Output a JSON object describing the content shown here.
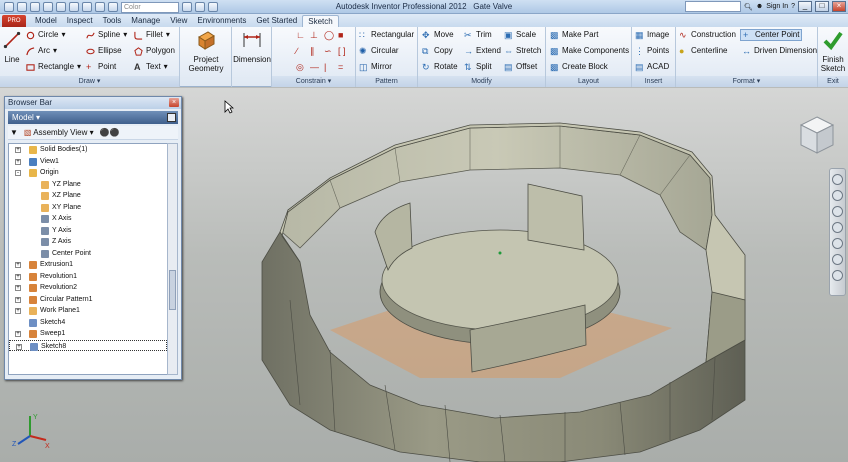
{
  "titlebar": {
    "title": "Autodesk Inventor Professional 2012",
    "doc": "Gate Valve",
    "color_combo": "Color",
    "sign_in": "Sign In"
  },
  "tabs": {
    "app_button": "PRO",
    "items": [
      "Model",
      "Inspect",
      "Tools",
      "Manage",
      "View",
      "Environments",
      "Get Started",
      "Sketch"
    ],
    "active": "Sketch"
  },
  "ribbon": {
    "draw": {
      "title": "Draw",
      "line": "Line",
      "circle": "Circle",
      "arc": "Arc",
      "rectangle": "Rectangle",
      "spline": "Spline",
      "ellipse": "Ellipse",
      "point": "Point",
      "fillet": "Fillet",
      "polygon": "Polygon",
      "text": "Text"
    },
    "project_geometry": [
      "Project",
      "Geometry"
    ],
    "dimension": "Dimension",
    "constrain": {
      "title": "Constrain"
    },
    "pattern": {
      "title": "Pattern",
      "rectangular": "Rectangular",
      "circular": "Circular",
      "mirror": "Mirror"
    },
    "modify": {
      "title": "Modify",
      "move": "Move",
      "copy": "Copy",
      "rotate": "Rotate",
      "trim": "Trim",
      "extend": "Extend",
      "split": "Split",
      "scale": "Scale",
      "stretch": "Stretch",
      "offset": "Offset"
    },
    "layout": {
      "title": "Layout",
      "make_part": "Make Part",
      "make_components": "Make Components",
      "create_block": "Create Block"
    },
    "insert": {
      "title": "Insert",
      "image": "Image",
      "points": "Points",
      "acad": "ACAD"
    },
    "format": {
      "title": "Format",
      "construction": "Construction",
      "center_point": "Center Point",
      "centerline": "Centerline",
      "driven_dimension": "Driven Dimension"
    },
    "exit": {
      "title": "Exit",
      "finish": [
        "Finish",
        "Sketch"
      ]
    }
  },
  "browser": {
    "title": "Browser Bar",
    "model_dropdown": "Model ▾",
    "view_dropdown": "Assembly View",
    "tree": [
      {
        "label": "Solid Bodies(1)",
        "level": 0,
        "expander": "+",
        "icon": "folder"
      },
      {
        "label": "View1",
        "level": 0,
        "expander": "+",
        "icon": "view"
      },
      {
        "label": "Origin",
        "level": 0,
        "expander": "-",
        "icon": "folder"
      },
      {
        "label": "YZ Plane",
        "level": 1,
        "expander": "",
        "icon": "plane"
      },
      {
        "label": "XZ Plane",
        "level": 1,
        "expander": "",
        "icon": "plane"
      },
      {
        "label": "XY Plane",
        "level": 1,
        "expander": "",
        "icon": "plane"
      },
      {
        "label": "X Axis",
        "level": 1,
        "expander": "",
        "icon": "axis"
      },
      {
        "label": "Y Axis",
        "level": 1,
        "expander": "",
        "icon": "axis"
      },
      {
        "label": "Z Axis",
        "level": 1,
        "expander": "",
        "icon": "axis"
      },
      {
        "label": "Center Point",
        "level": 1,
        "expander": "",
        "icon": "point"
      },
      {
        "label": "Extrusion1",
        "level": 0,
        "expander": "+",
        "icon": "feature"
      },
      {
        "label": "Revolution1",
        "level": 0,
        "expander": "+",
        "icon": "feature"
      },
      {
        "label": "Revolution2",
        "level": 0,
        "expander": "+",
        "icon": "feature"
      },
      {
        "label": "Circular Pattern1",
        "level": 0,
        "expander": "+",
        "icon": "feature"
      },
      {
        "label": "Work Plane1",
        "level": 0,
        "expander": "+",
        "icon": "plane"
      },
      {
        "label": "Sketch4",
        "level": 0,
        "expander": "",
        "icon": "sketch"
      },
      {
        "label": "Sweep1",
        "level": 0,
        "expander": "+",
        "icon": "feature"
      },
      {
        "label": "Sketch8",
        "level": 0,
        "expander": "+",
        "icon": "sketch"
      }
    ]
  },
  "triad": {
    "x": "X",
    "y": "Y",
    "z": "Z"
  }
}
